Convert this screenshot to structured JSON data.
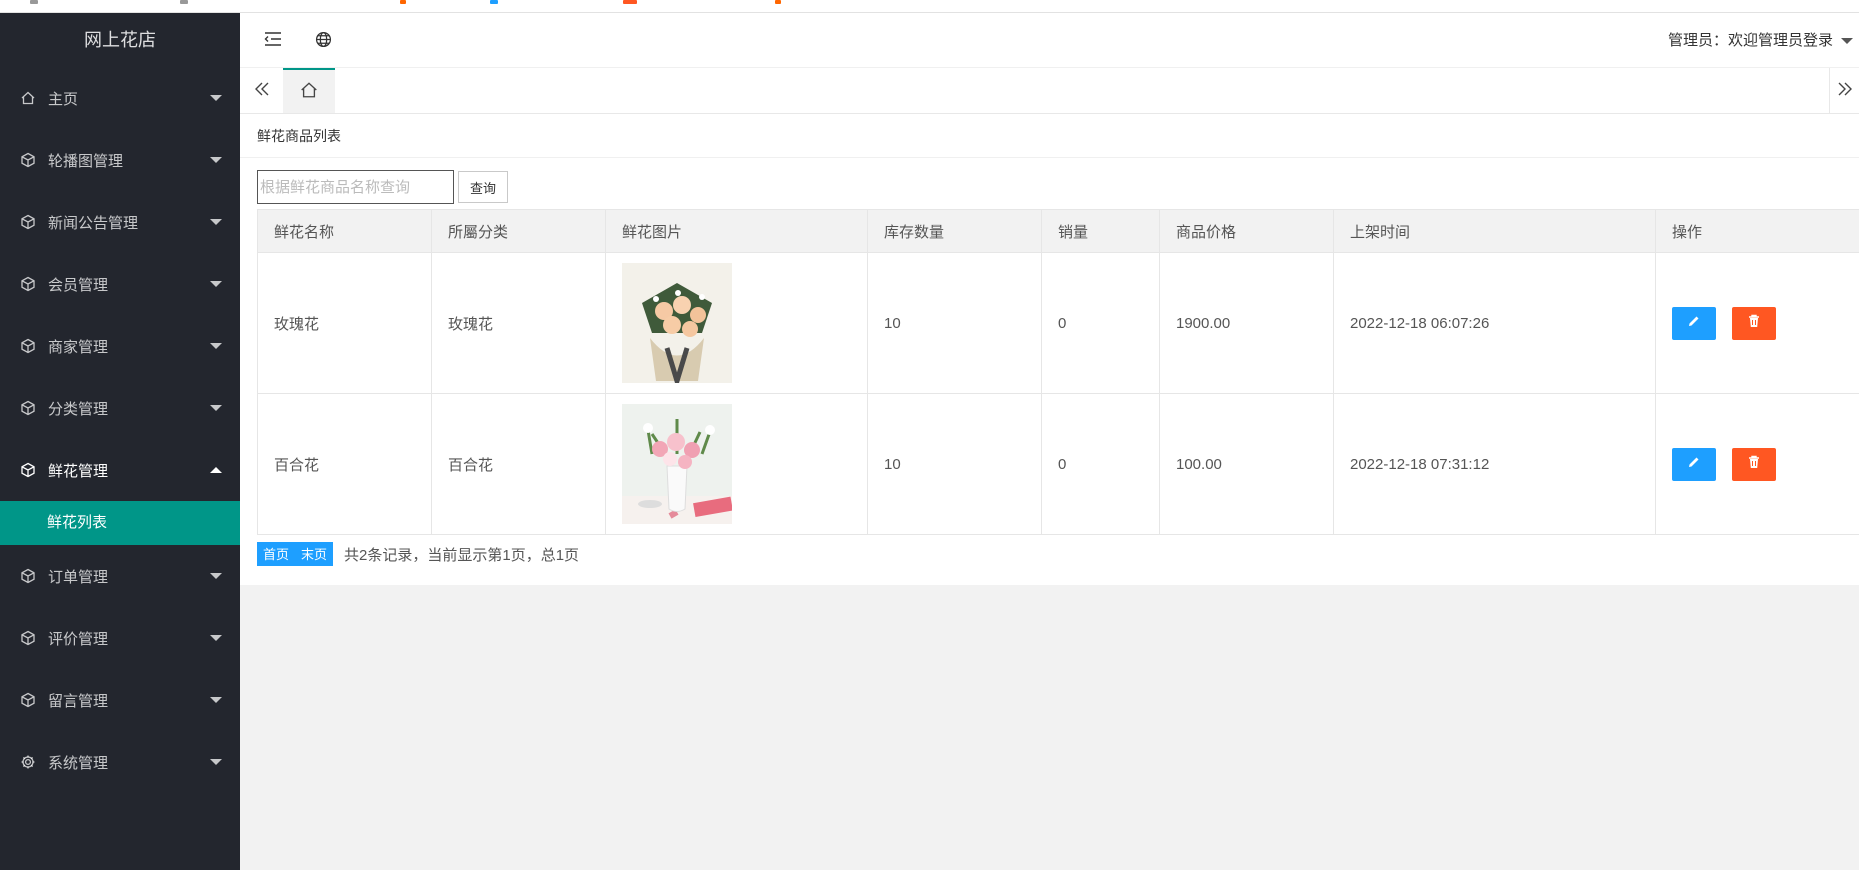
{
  "app": {
    "title": "网上花店"
  },
  "header": {
    "admin_label": "管理员：欢迎管理员登录"
  },
  "sidebar": {
    "items": [
      {
        "label": "主页",
        "icon": "home-icon"
      },
      {
        "label": "轮播图管理",
        "icon": "cube-icon"
      },
      {
        "label": "新闻公告管理",
        "icon": "cube-icon"
      },
      {
        "label": "会员管理",
        "icon": "cube-icon"
      },
      {
        "label": "商家管理",
        "icon": "cube-icon"
      },
      {
        "label": "分类管理",
        "icon": "cube-icon"
      },
      {
        "label": "鲜花管理",
        "icon": "cube-icon",
        "expanded": true,
        "children": [
          {
            "label": "鲜花列表",
            "active": true
          }
        ]
      },
      {
        "label": "订单管理",
        "icon": "cube-icon"
      },
      {
        "label": "评价管理",
        "icon": "cube-icon"
      },
      {
        "label": "留言管理",
        "icon": "cube-icon"
      },
      {
        "label": "系统管理",
        "icon": "gear-icon"
      }
    ]
  },
  "main": {
    "card_title": "鲜花商品列表",
    "search": {
      "placeholder": "根据鲜花商品名称查询",
      "value": "",
      "button": "查询"
    },
    "table": {
      "columns": [
        "鲜花名称",
        "所屬分类",
        "鲜花图片",
        "库存数量",
        "销量",
        "商品价格",
        "上架时间",
        "操作"
      ],
      "rows": [
        {
          "name": "玫瑰花",
          "category": "玫瑰花",
          "image": "rose-bouquet-photo",
          "stock": "10",
          "sales": "0",
          "price": "1900.00",
          "listed": "2022-12-18 06:07:26"
        },
        {
          "name": "百合花",
          "category": "百合花",
          "image": "lily-vase-photo",
          "stock": "10",
          "sales": "0",
          "price": "100.00",
          "listed": "2022-12-18 07:31:12"
        }
      ]
    },
    "pager": {
      "first": "首页",
      "last": "末页",
      "info": "共2条记录，当前显示第1页，总1页"
    }
  },
  "colors": {
    "sidebar_bg": "#23262e",
    "accent": "#009688",
    "edit": "#1e9fff",
    "delete": "#ff5722"
  }
}
